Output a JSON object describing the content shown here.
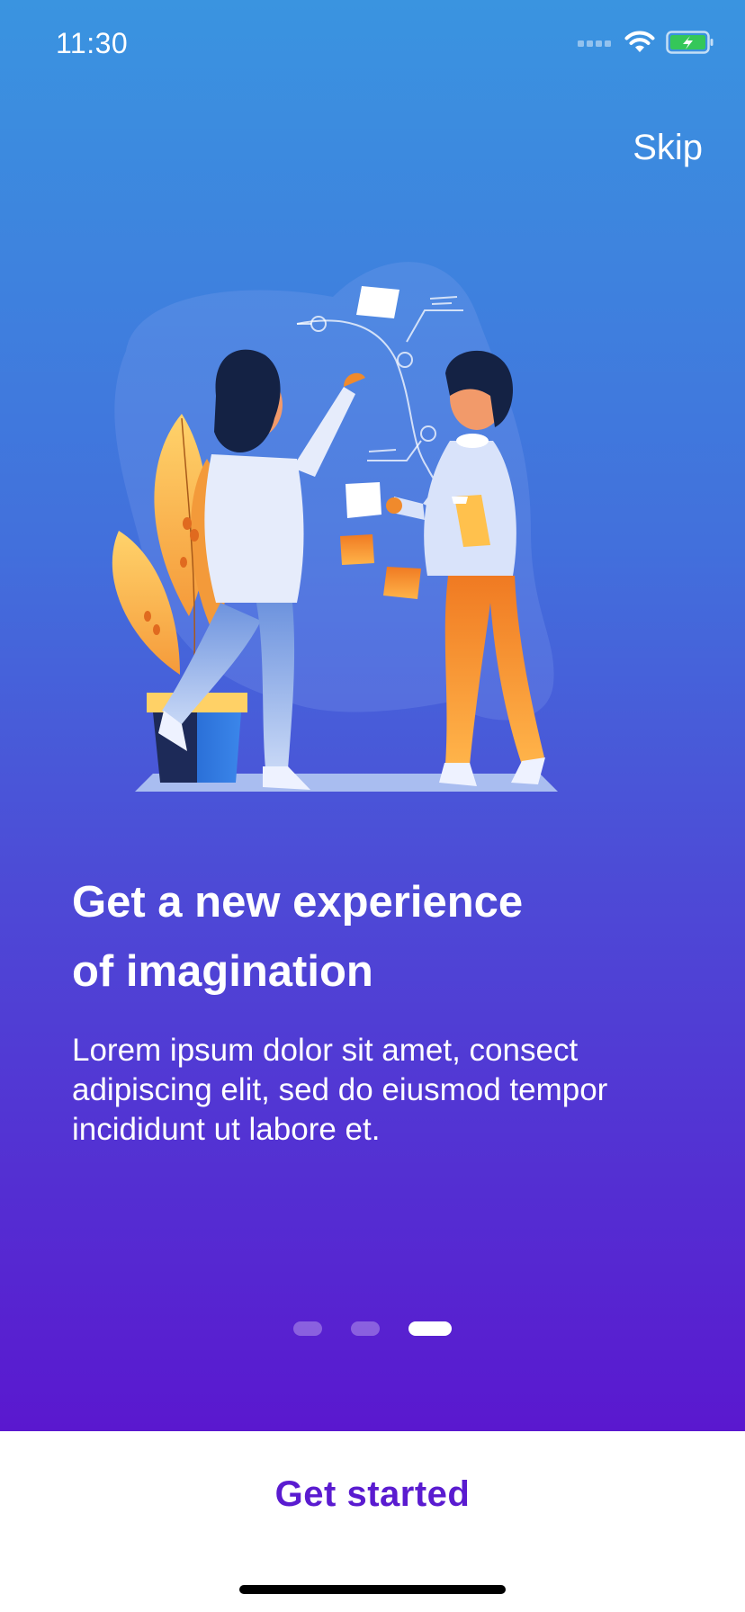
{
  "status_bar": {
    "time": "11:30",
    "icons": [
      "signal-icon",
      "wifi-icon",
      "battery-charging-icon"
    ]
  },
  "onboarding": {
    "skip_label": "Skip",
    "headline_line1": "Get a new experience",
    "headline_line2": "of imagination",
    "body": "Lorem ipsum dolor sit amet, consect adipiscing elit, sed do eiusmod tempor incididunt ut labore et.",
    "page_count": 3,
    "current_page": 3,
    "illustration": "two-people-brainstorming-illustration"
  },
  "footer": {
    "cta_label": "Get started"
  },
  "colors": {
    "gradient_top": "#3a94e0",
    "gradient_bottom": "#5a18cf",
    "accent": "#5a1bd0",
    "orange": "#f08a2c",
    "white": "#ffffff"
  }
}
